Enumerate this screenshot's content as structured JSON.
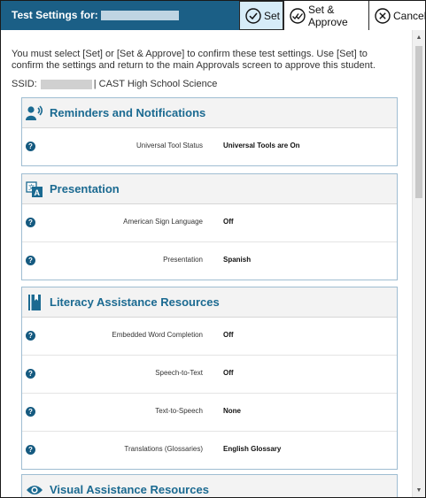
{
  "titlebar": {
    "title": "Test Settings for:",
    "set_label": "Set",
    "set_approve_label": "Set & Approve",
    "cancel_label": "Cancel"
  },
  "intro_text": "You must select [Set] or [Set & Approve] to confirm these test settings. Use [Set] to confirm the settings and return to the main Approvals screen to approve this student.",
  "ssid": {
    "label": "SSID:",
    "suffix": "| CAST High School Science"
  },
  "sections": [
    {
      "title": "Reminders and Notifications",
      "icon": "bell-person-icon",
      "rows": [
        {
          "label": "Universal Tool Status",
          "value": "Universal Tools are On"
        }
      ]
    },
    {
      "title": "Presentation",
      "icon": "translate-icon",
      "rows": [
        {
          "label": "American Sign Language",
          "value": "Off"
        },
        {
          "label": "Presentation",
          "value": "Spanish"
        }
      ]
    },
    {
      "title": "Literacy Assistance Resources",
      "icon": "book-icon",
      "rows": [
        {
          "label": "Embedded Word Completion",
          "value": "Off"
        },
        {
          "label": "Speech-to-Text",
          "value": "Off"
        },
        {
          "label": "Text-to-Speech",
          "value": "None"
        },
        {
          "label": "Translations (Glossaries)",
          "value": "English Glossary"
        }
      ]
    },
    {
      "title": "Visual Assistance Resources",
      "icon": "eye-icon",
      "rows": []
    }
  ],
  "help_glyph": "?",
  "colors": {
    "titlebar": "#1b5f86",
    "accent": "#1b6a91",
    "section_border": "#9fbdd2"
  }
}
